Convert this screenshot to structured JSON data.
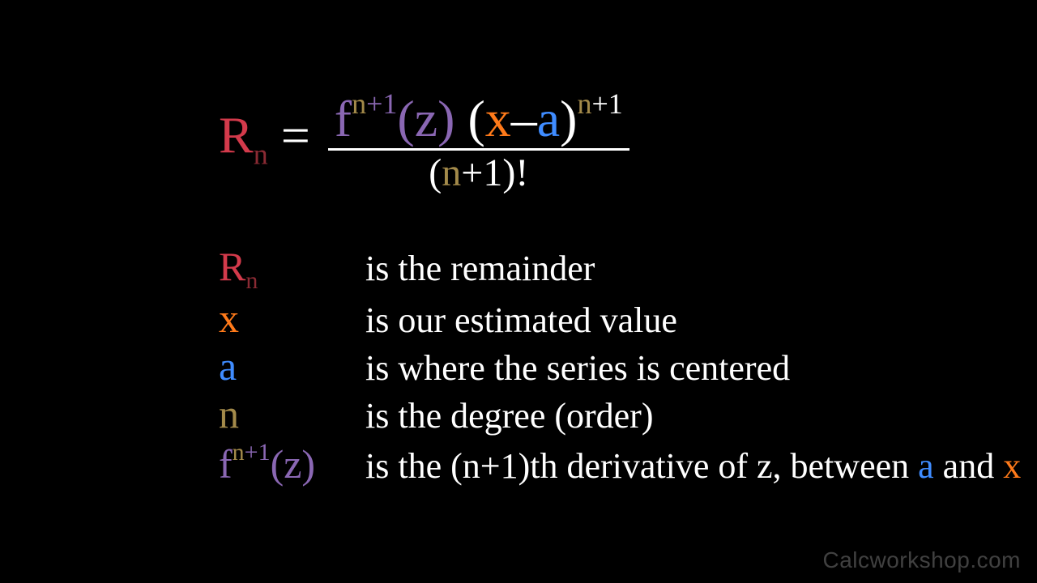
{
  "watermark": "Calcworkshop.com",
  "formula": {
    "R": "R",
    "R_sub": "n",
    "eq": " = ",
    "f": "f",
    "f_sup_pre": "n",
    "f_sup_plus": "+1",
    "f_arg": "(z)",
    "op_open": "(",
    "x": "x",
    "dash": "–",
    "a": "a",
    "op_close": ")",
    "outer_sup_pre": "n",
    "outer_sup_plus": "+1",
    "den_open": "(",
    "den_n": "n",
    "den_plus": "+1",
    "den_close": ")!"
  },
  "legend": {
    "rows": [
      {
        "sym_html": "Rn",
        "desc": " is the remainder"
      },
      {
        "sym_html": "x",
        "desc": " is our estimated value"
      },
      {
        "sym_html": "a",
        "desc": " is where the series is centered"
      },
      {
        "sym_html": "n",
        "desc": " is the degree (order)"
      },
      {
        "sym_html": "fn1z",
        "desc_pre": " is the ",
        "desc_post": " and "
      }
    ],
    "deriv_text": "(n+1)th derivative of z, between ",
    "a2": "a",
    "and": " and ",
    "x2": "x"
  }
}
